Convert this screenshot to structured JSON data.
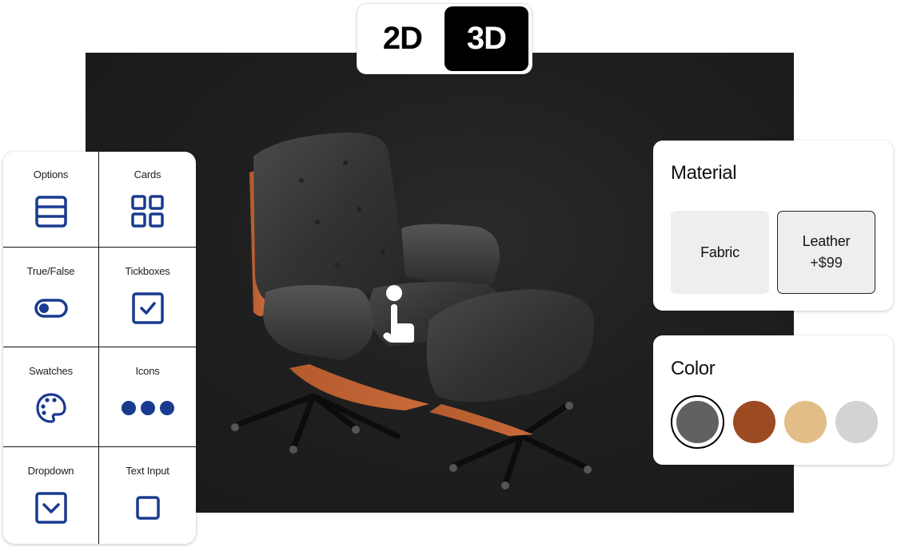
{
  "view_toggle": {
    "options": [
      {
        "label": "2D",
        "active": false
      },
      {
        "label": "3D",
        "active": true
      }
    ]
  },
  "viewport": {
    "subject": "Lounge chair with ottoman (3D model)",
    "hint_icon": "drag-hand-icon"
  },
  "input_types": {
    "items": [
      {
        "label": "Options",
        "icon": "list-rows-icon"
      },
      {
        "label": "Cards",
        "icon": "grid-cards-icon"
      },
      {
        "label": "True/False",
        "icon": "toggle-icon"
      },
      {
        "label": "Tickboxes",
        "icon": "checkbox-icon"
      },
      {
        "label": "Swatches",
        "icon": "palette-icon"
      },
      {
        "label": "Icons",
        "icon": "dots-icon"
      },
      {
        "label": "Dropdown",
        "icon": "dropdown-icon"
      },
      {
        "label": "Text Input",
        "icon": "text-input-icon"
      }
    ],
    "icon_color": "#1a3a8f"
  },
  "material": {
    "title": "Material",
    "options": [
      {
        "name": "Fabric",
        "price": "",
        "selected": false
      },
      {
        "name": "Leather",
        "price": "+$99",
        "selected": true
      }
    ]
  },
  "color": {
    "title": "Color",
    "swatches": [
      {
        "name": "dark-gray",
        "hex": "#616161",
        "selected": true
      },
      {
        "name": "rust-brown",
        "hex": "#9c4a21",
        "selected": false
      },
      {
        "name": "tan",
        "hex": "#e3bd88",
        "selected": false
      },
      {
        "name": "light-gray",
        "hex": "#d3d3d3",
        "selected": false
      }
    ]
  }
}
